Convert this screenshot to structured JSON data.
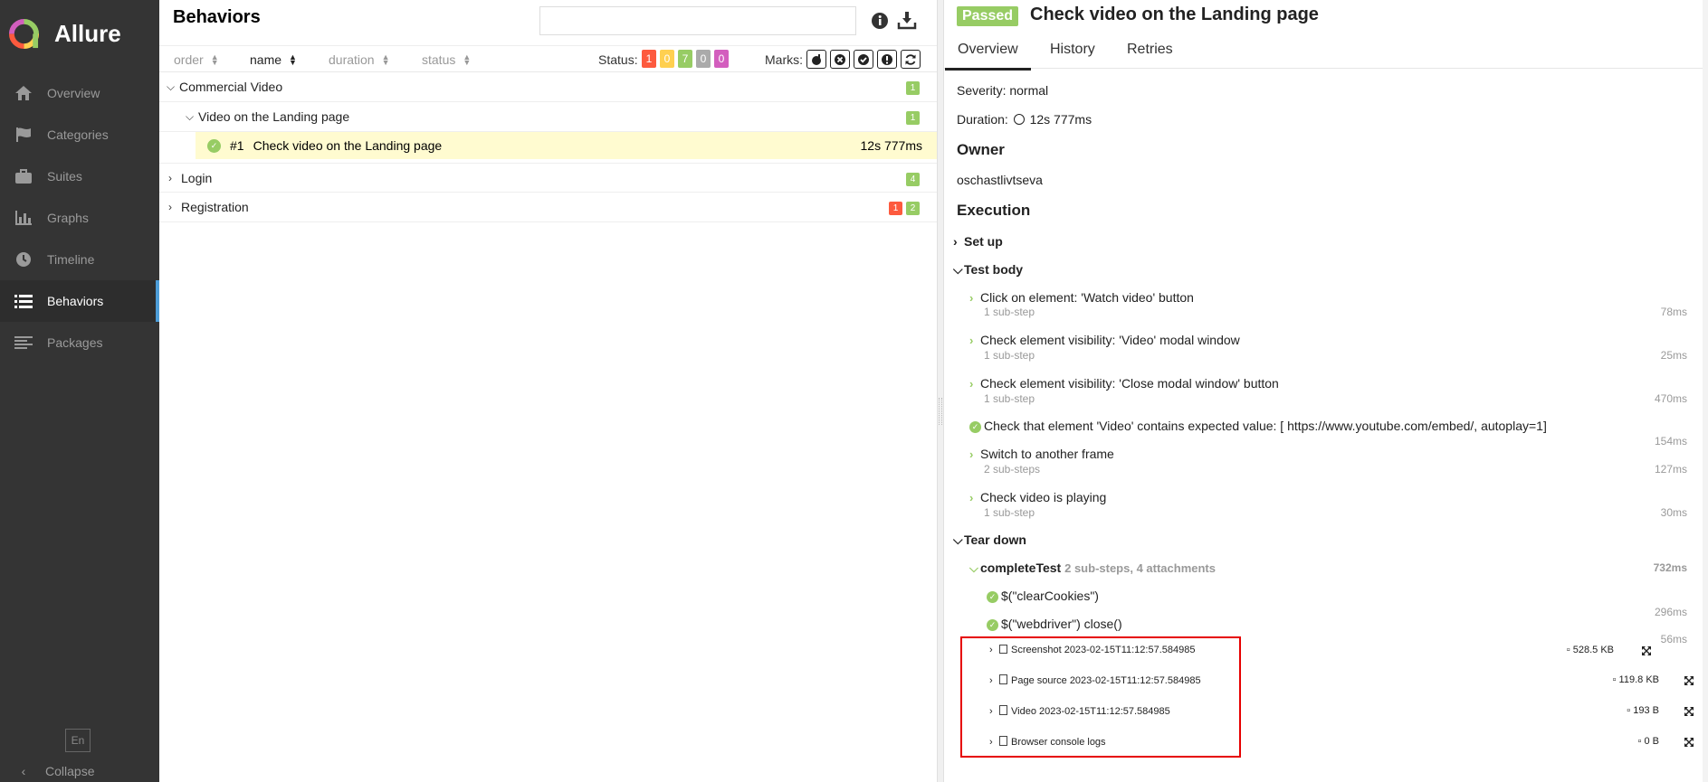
{
  "app": {
    "name": "Allure"
  },
  "sidebar": {
    "items": [
      {
        "label": "Overview",
        "icon": "home-icon"
      },
      {
        "label": "Categories",
        "icon": "flag-icon"
      },
      {
        "label": "Suites",
        "icon": "briefcase-icon"
      },
      {
        "label": "Graphs",
        "icon": "bar-chart-icon"
      },
      {
        "label": "Timeline",
        "icon": "clock-icon"
      },
      {
        "label": "Behaviors",
        "icon": "list-icon",
        "active": true
      },
      {
        "label": "Packages",
        "icon": "align-left-icon"
      }
    ],
    "language": "En",
    "collapse_label": "Collapse"
  },
  "behaviors": {
    "title": "Behaviors",
    "search_value": "",
    "sort": {
      "order": "order",
      "name": "name",
      "duration": "duration",
      "status": "status"
    },
    "status_label": "Status:",
    "status_counts": {
      "failed": "1",
      "broken": "0",
      "passed": "7",
      "skipped": "0",
      "unknown": "0"
    },
    "marks_label": "Marks:",
    "tree": {
      "commercial_video": {
        "label": "Commercial Video",
        "count": "1"
      },
      "video_landing": {
        "label": "Video on the Landing page",
        "count": "1"
      },
      "leaf": {
        "index": "#1",
        "label": "Check video on the Landing page",
        "duration": "12s 777ms"
      },
      "login": {
        "label": "Login",
        "count": "4"
      },
      "registration": {
        "label": "Registration",
        "failed": "1",
        "passed": "2"
      }
    }
  },
  "test": {
    "status": "Passed",
    "title": "Check video on the Landing page",
    "tabs": [
      "Overview",
      "History",
      "Retries"
    ],
    "severity": "Severity: normal",
    "duration": "Duration:",
    "duration_value": "12s 777ms",
    "owner_heading": "Owner",
    "owner": "oschastlivtseva",
    "execution_heading": "Execution",
    "setup": "Set up",
    "test_body": "Test body",
    "steps": [
      {
        "label": "Click on element: 'Watch video' button",
        "sub": "1 sub-step",
        "duration": "78ms"
      },
      {
        "label": "Check element visibility: 'Video' modal window",
        "sub": "1 sub-step",
        "duration": "25ms"
      },
      {
        "label": "Check element visibility: 'Close modal window' button",
        "sub": "1 sub-step",
        "duration": "470ms"
      },
      {
        "label": "Check that element 'Video' contains expected value: [ https://www.youtube.com/embed/, autoplay=1]",
        "duration": "154ms"
      },
      {
        "label": "Switch to another frame",
        "sub": "2 sub-steps",
        "duration": "127ms"
      },
      {
        "label": "Check video is playing",
        "sub": "1 sub-step",
        "duration": "30ms"
      }
    ],
    "tear_down": "Tear down",
    "complete_test": {
      "label": "completeTest",
      "meta": "2 sub-steps, 4 attachments",
      "duration": "732ms"
    },
    "teardown_steps": [
      {
        "label": "$(\"clearCookies\")",
        "duration": "296ms"
      },
      {
        "label": "$(\"webdriver\") close()",
        "duration": "56ms"
      }
    ],
    "attachments": [
      {
        "label": "Screenshot 2023-02-15T11:12:57.584985",
        "size": "528.5 KB",
        "icon": "image-icon"
      },
      {
        "label": "Page source 2023-02-15T11:12:57.584985",
        "size": "119.8 KB",
        "icon": "file-icon"
      },
      {
        "label": "Video 2023-02-15T11:12:57.584985",
        "size": "193 B",
        "icon": "file-icon"
      },
      {
        "label": "Browser console logs",
        "size": "0 B",
        "icon": "file-icon"
      }
    ]
  },
  "colors": {
    "sidebar_bg": "#343434",
    "active_accent": "#4d9dd8",
    "passed": "#97cc64",
    "failed": "#fd5a3e",
    "broken": "#ffd050",
    "skipped": "#aaaaaa",
    "unknown": "#d35ebe",
    "highlight_row": "#fffbd0",
    "annotation_box": "#e60000"
  }
}
